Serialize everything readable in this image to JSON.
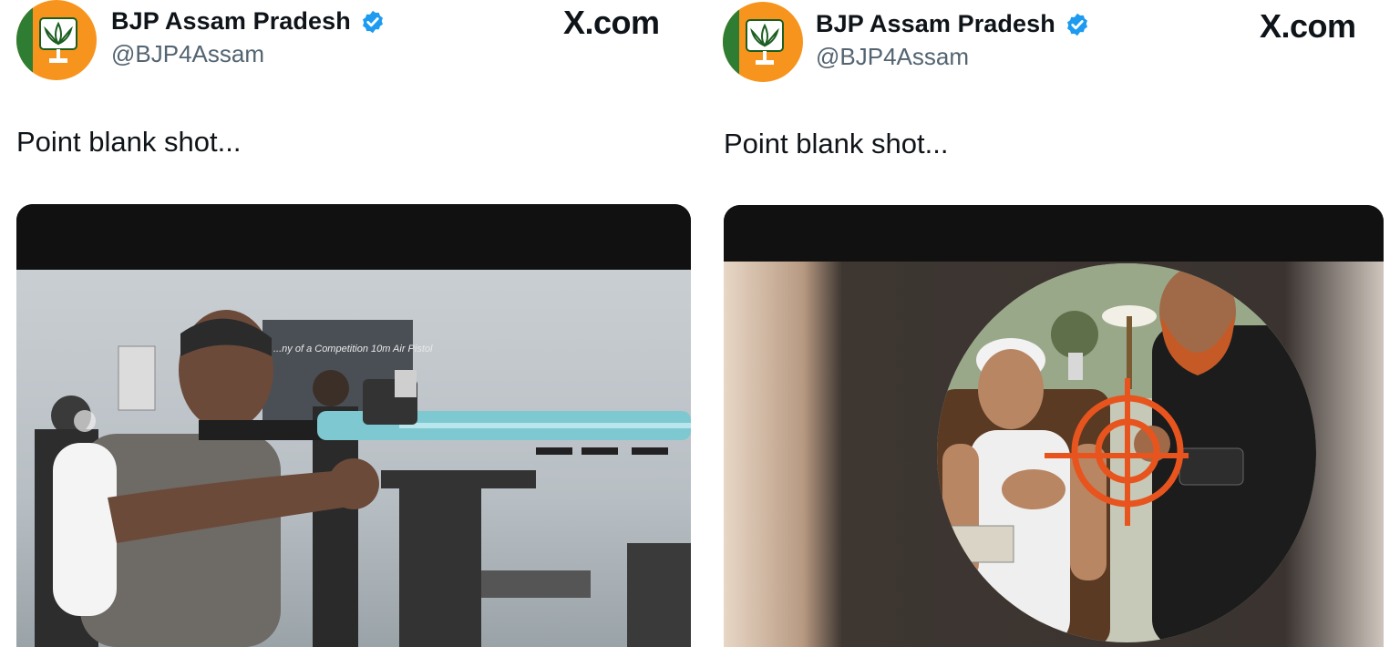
{
  "tweets": [
    {
      "account_name": "BJP Assam Pradesh",
      "handle": "@BJP4Assam",
      "verified": true,
      "source_brand": "X.com",
      "text": "Point blank shot...",
      "media_caption_fragment": "...ny of a Competition 10m Air Pistol"
    },
    {
      "account_name": "BJP Assam Pradesh",
      "handle": "@BJP4Assam",
      "verified": true,
      "source_brand": "X.com",
      "text": "Point blank shot..."
    }
  ],
  "colors": {
    "verified_badge": "#1d9bf0",
    "avatar_bg": "#f7941d",
    "handle_text": "#536471",
    "crosshair": "#e8541e"
  },
  "icons": [
    "lotus-logo-icon",
    "verified-badge-icon",
    "x-logo-icon",
    "crosshair-icon"
  ]
}
